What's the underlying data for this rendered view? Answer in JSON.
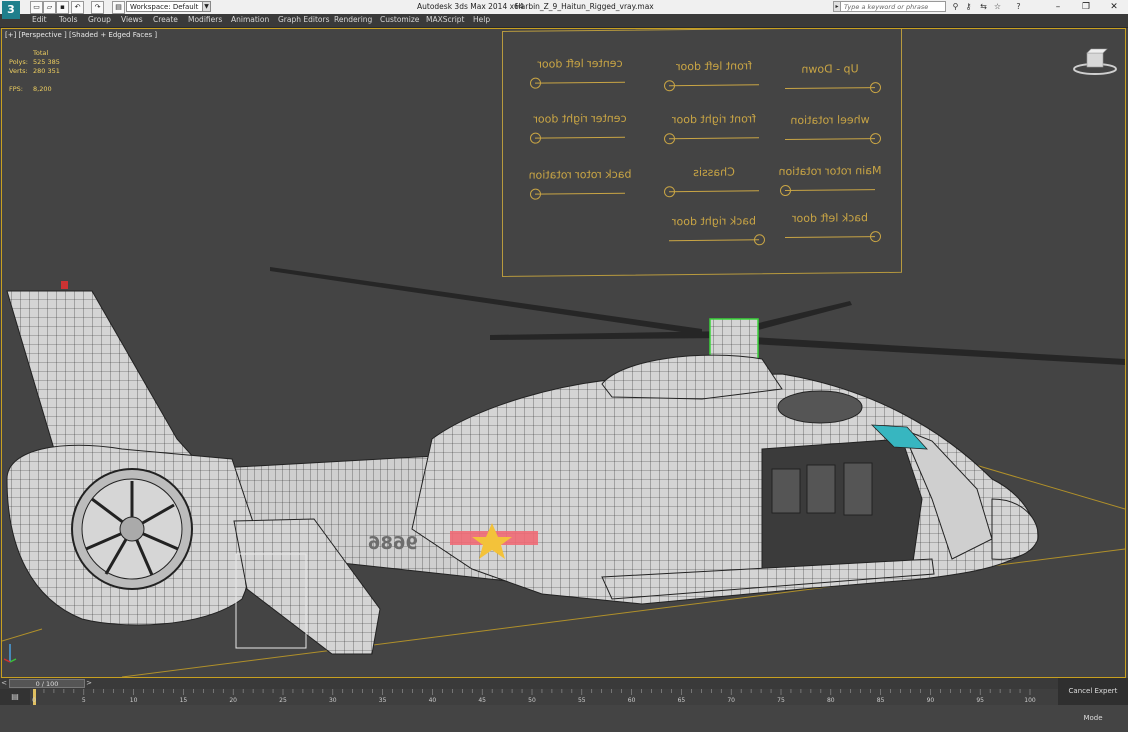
{
  "titlebar": {
    "app_title": "Autodesk 3ds Max  2014 x64",
    "file_name": "Harbin_Z_9_Haitun_Rigged_vray.max",
    "workspace": "Workspace: Default",
    "search_placeholder": "Type a keyword or phrase"
  },
  "menu": [
    "Edit",
    "Tools",
    "Group",
    "Views",
    "Create",
    "Modifiers",
    "Animation",
    "Graph Editors",
    "Rendering",
    "Customize",
    "MAXScript",
    "Help"
  ],
  "viewport": {
    "label": "[+] [Perspective ] [Shaded + Edged Faces ]",
    "stats": {
      "header": "Total",
      "polys_label": "Polys:",
      "polys_value": "525 385",
      "verts_label": "Verts:",
      "verts_value": "280 351",
      "fps_label": "FPS:",
      "fps_value": "8,200"
    },
    "hull_number": "9686"
  },
  "rig_controls": [
    {
      "label": "center left door",
      "knob": 0.0
    },
    {
      "label": "front left door",
      "knob": 0.0
    },
    {
      "label": "Up - Down",
      "knob": 1.0
    },
    {
      "label": "center right door",
      "knob": 0.0
    },
    {
      "label": "front right door",
      "knob": 0.0
    },
    {
      "label": "wheel rotation",
      "knob": 1.0
    },
    {
      "label": "back rotor rotation",
      "knob": 0.0
    },
    {
      "label": "Chassis",
      "knob": 0.0
    },
    {
      "label": "Main rotor rotation",
      "knob": 0.0
    },
    {
      "label": "back right door",
      "knob": 1.0
    },
    {
      "label": "back left door",
      "knob": 1.0
    }
  ],
  "timeline": {
    "frame_display": "0 / 100",
    "ticks": [
      "0",
      "5",
      "10",
      "15",
      "20",
      "25",
      "30",
      "35",
      "40",
      "45",
      "50",
      "55",
      "60",
      "65",
      "70",
      "75",
      "80",
      "85",
      "90",
      "95",
      "100"
    ]
  },
  "status": {
    "expert_button": "Cancel Expert Mode"
  },
  "colors": {
    "accent": "#c9a545",
    "viewport_bg": "#444444",
    "stats_text": "#f0d060"
  }
}
